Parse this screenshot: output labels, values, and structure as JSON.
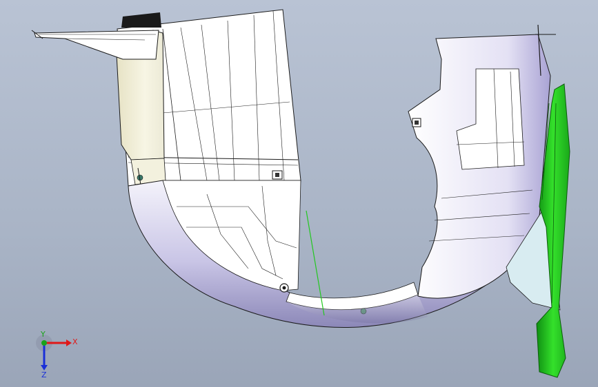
{
  "viewport": {
    "background_color": "#a9b4c6",
    "model_colors": {
      "shell": "#ffffff",
      "shading": "#b9b4d9",
      "tank": "#f1eed6",
      "edges": "#1a1a1a",
      "clip": "#22c81f",
      "glass": "#d8ecf1",
      "cap": "#1a1a1a",
      "normal_line": "#22c81f"
    }
  },
  "triad": {
    "x_label": "X",
    "y_label": "Y",
    "z_label": "Z",
    "x_color": "#e01818",
    "y_color": "#1aa31a",
    "z_color": "#1a30d8"
  }
}
